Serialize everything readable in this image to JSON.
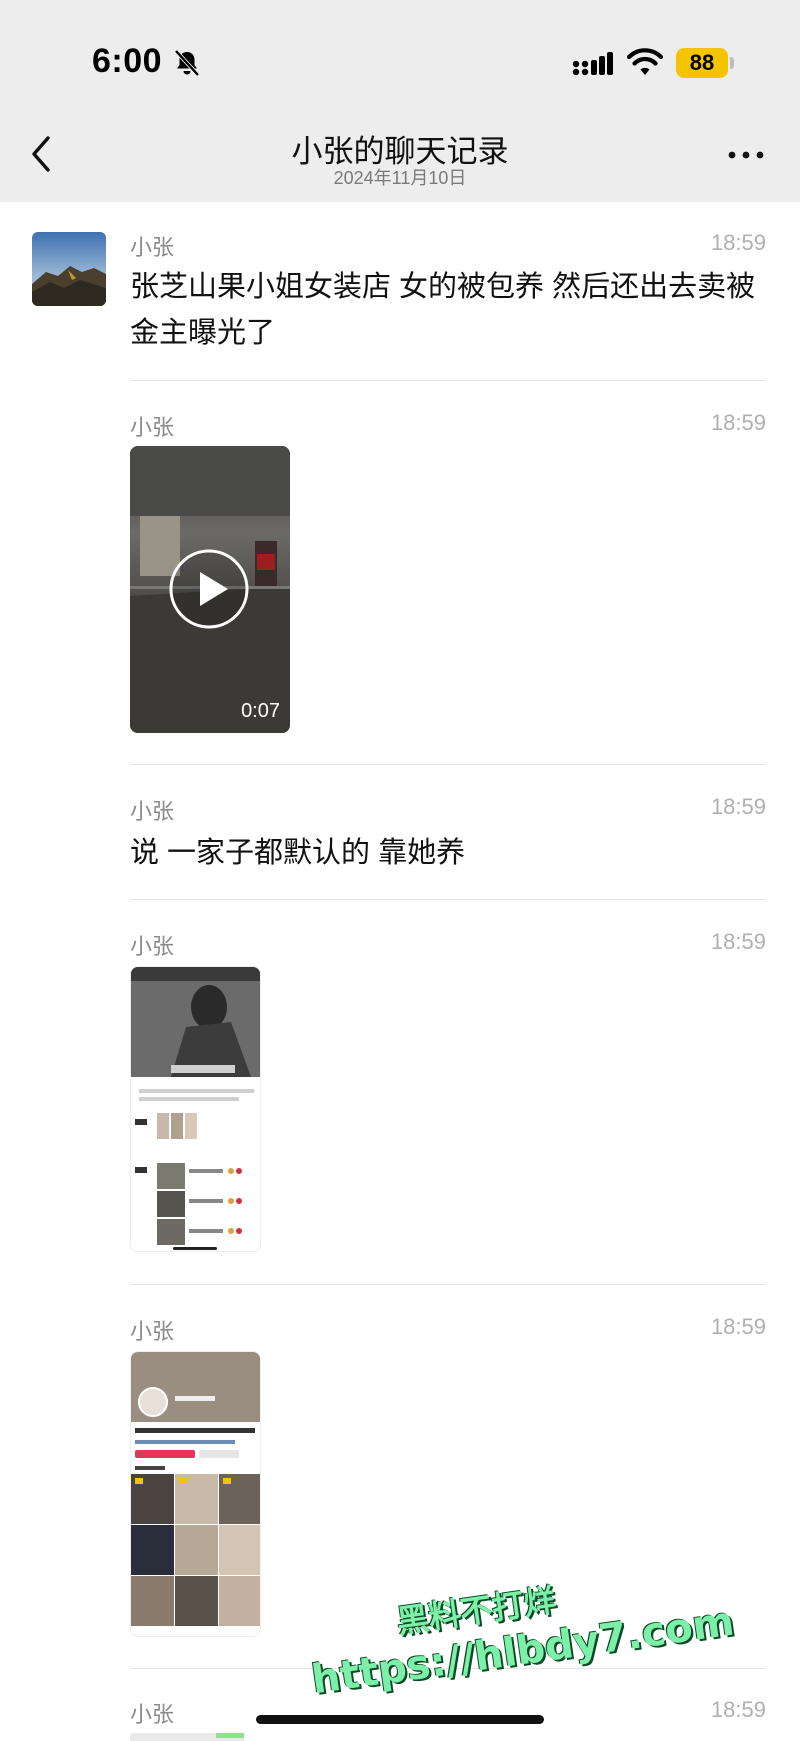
{
  "status_bar": {
    "time": "6:00",
    "battery": "88"
  },
  "header": {
    "back_icon": "chevron-left-icon",
    "title": "小张的聊天记录",
    "subtitle": "2024年11月10日",
    "more_icon": "more-dots-icon"
  },
  "messages": [
    {
      "sender": "小张",
      "time": "18:59",
      "type": "text",
      "text": "张芝山果小姐女装店 女的被包养 然后还出去卖被金主曝光了"
    },
    {
      "sender": "小张",
      "time": "18:59",
      "type": "video",
      "duration": "0:07"
    },
    {
      "sender": "小张",
      "time": "18:59",
      "type": "text",
      "text": "说 一家子都默认的 靠她养"
    },
    {
      "sender": "小张",
      "time": "18:59",
      "type": "image"
    },
    {
      "sender": "小张",
      "time": "18:59",
      "type": "image"
    },
    {
      "sender": "小张",
      "time": "18:59",
      "type": "image"
    }
  ],
  "watermark": {
    "line1": "黑料不打烊",
    "line2": "https://hlbdy7.com"
  },
  "colors": {
    "header_bg": "#ededed",
    "battery": "#f5c400",
    "watermark": "#7cf0a8"
  }
}
